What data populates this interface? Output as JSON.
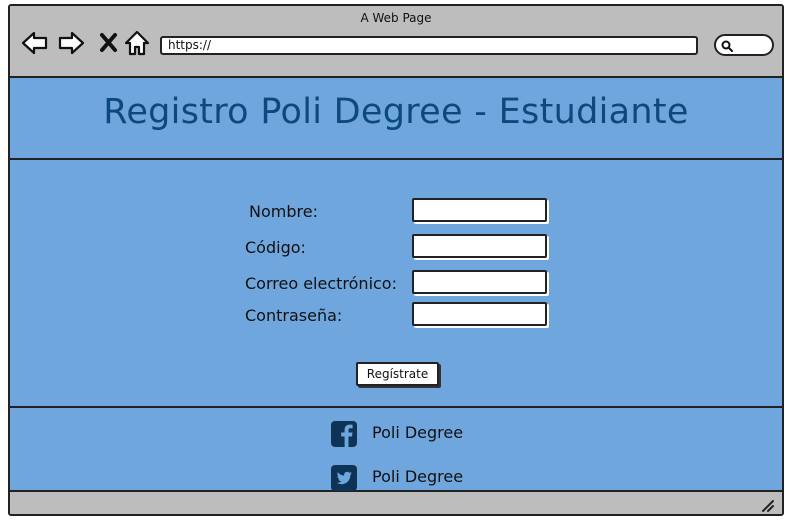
{
  "browser": {
    "window_title": "A Web Page",
    "url": "https://"
  },
  "page": {
    "title": "Registro Poli Degree - Estudiante"
  },
  "form": {
    "fields": [
      {
        "label": "Nombre:",
        "value": ""
      },
      {
        "label": "Código:",
        "value": ""
      },
      {
        "label": "Correo electrónico:",
        "value": ""
      },
      {
        "label": "Contraseña:",
        "value": ""
      }
    ],
    "submit_label": "Regístrate"
  },
  "footer": {
    "social": [
      {
        "icon": "facebook-icon",
        "label": "Poli Degree"
      },
      {
        "icon": "twitter-icon",
        "label": "Poli Degree"
      }
    ]
  },
  "colors": {
    "page_background": "#6fa6dd",
    "title_color": "#0c4a7d",
    "chrome_background": "#bdbdbd",
    "social_icon": "#0d3355"
  }
}
